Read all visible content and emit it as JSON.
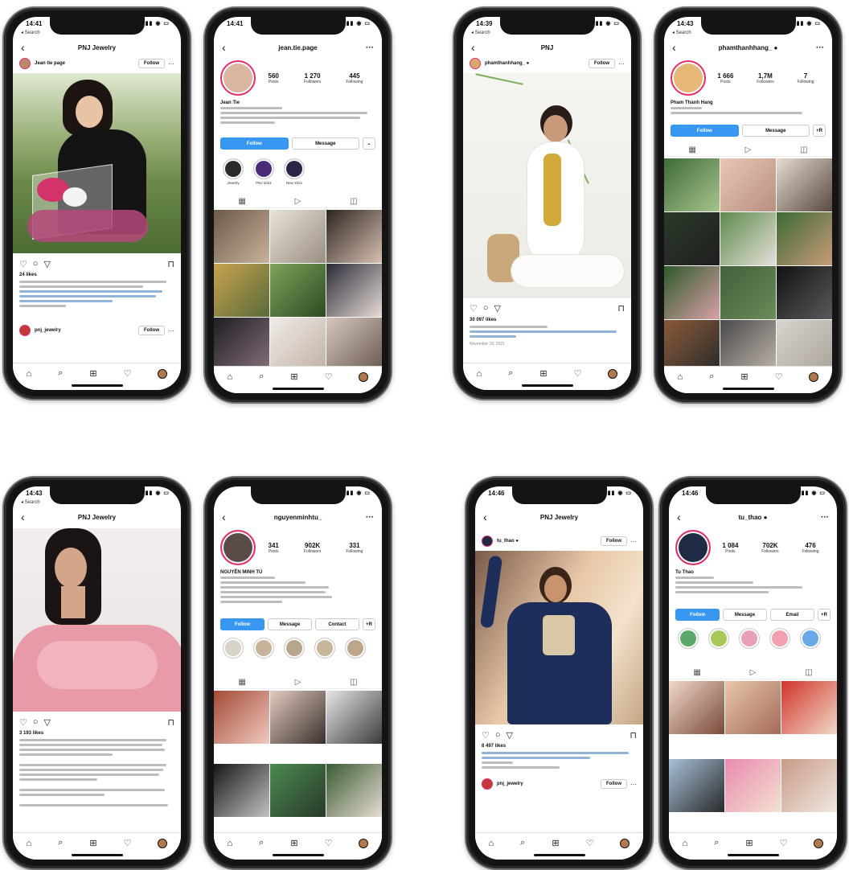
{
  "tabbar": {
    "home": "⌂",
    "search": "⌕",
    "add": "⊞",
    "heart": "♡"
  },
  "actions": {
    "like": "♡",
    "comment": "○",
    "share": "▽",
    "save": "⊓"
  },
  "common": {
    "back": "‹",
    "more": "···",
    "follow": "Follow",
    "grid": "▦",
    "reels": "▷",
    "tagged": "◫"
  },
  "phones": [
    {
      "time": "14:41",
      "back_search": "◂ Search",
      "nav_title": "PNJ Jewelry",
      "post_user": "Jean tie page",
      "likes": "24 likes",
      "bottom_user": "pnj_jewelry"
    },
    {
      "time": "14:41",
      "nav_title": "jean.tie.page",
      "posts": "560",
      "posts_label": "Posts",
      "followers": "1 270",
      "followers_label": "Followers",
      "following": "445",
      "following_label": "Following",
      "name": "Jean Tie",
      "btn_follow": "Follow",
      "btn_message": "Message",
      "btn_more": "⌄",
      "hl1": "Jewelry",
      "hl2": "PNJ 2021",
      "hl3": "New 2021"
    },
    {
      "time": "14:39",
      "back_search": "◂ Search",
      "nav_title": "PNJ",
      "post_user": "phamthanhhang_ ●",
      "likes": "30 097 likes",
      "date": "November 18, 2021"
    },
    {
      "time": "14:43",
      "back_search": "◂ Search",
      "nav_title": "phamthanhhang_ ●",
      "posts": "1 666",
      "posts_label": "Posts",
      "followers": "1,7M",
      "followers_label": "Followers",
      "following": "7",
      "following_label": "Following",
      "name": "Pham Thanh Hang",
      "btn_follow": "Follow",
      "btn_message": "Message",
      "btn_more": "+R"
    },
    {
      "time": "14:43",
      "back_search": "◂ Search",
      "nav_title": "PNJ Jewelry",
      "likes": "3 193 likes"
    },
    {
      "time": "",
      "nav_title": "nguyenminhtu_",
      "posts": "341",
      "posts_label": "Posts",
      "followers": "902K",
      "followers_label": "Followers",
      "following": "331",
      "following_label": "Following",
      "name": "NGUYỄN MINH TÚ",
      "btn_follow": "Follow",
      "btn_message": "Message",
      "btn_contact": "Contact",
      "btn_more": "+R"
    },
    {
      "time": "14:46",
      "nav_title": "PNJ Jewelry",
      "post_user": "tu_thao ●",
      "likes": "8 497 likes",
      "bottom_user": "pnj_jewelry"
    },
    {
      "time": "14:46",
      "nav_title": "tu_thao ●",
      "posts": "1 084",
      "posts_label": "Posts",
      "followers": "702K",
      "followers_label": "Followers",
      "following": "476",
      "following_label": "Following",
      "name": "Tu Thao",
      "btn_follow": "Follow",
      "btn_message": "Message",
      "btn_email": "Email",
      "btn_more": "+R"
    }
  ]
}
